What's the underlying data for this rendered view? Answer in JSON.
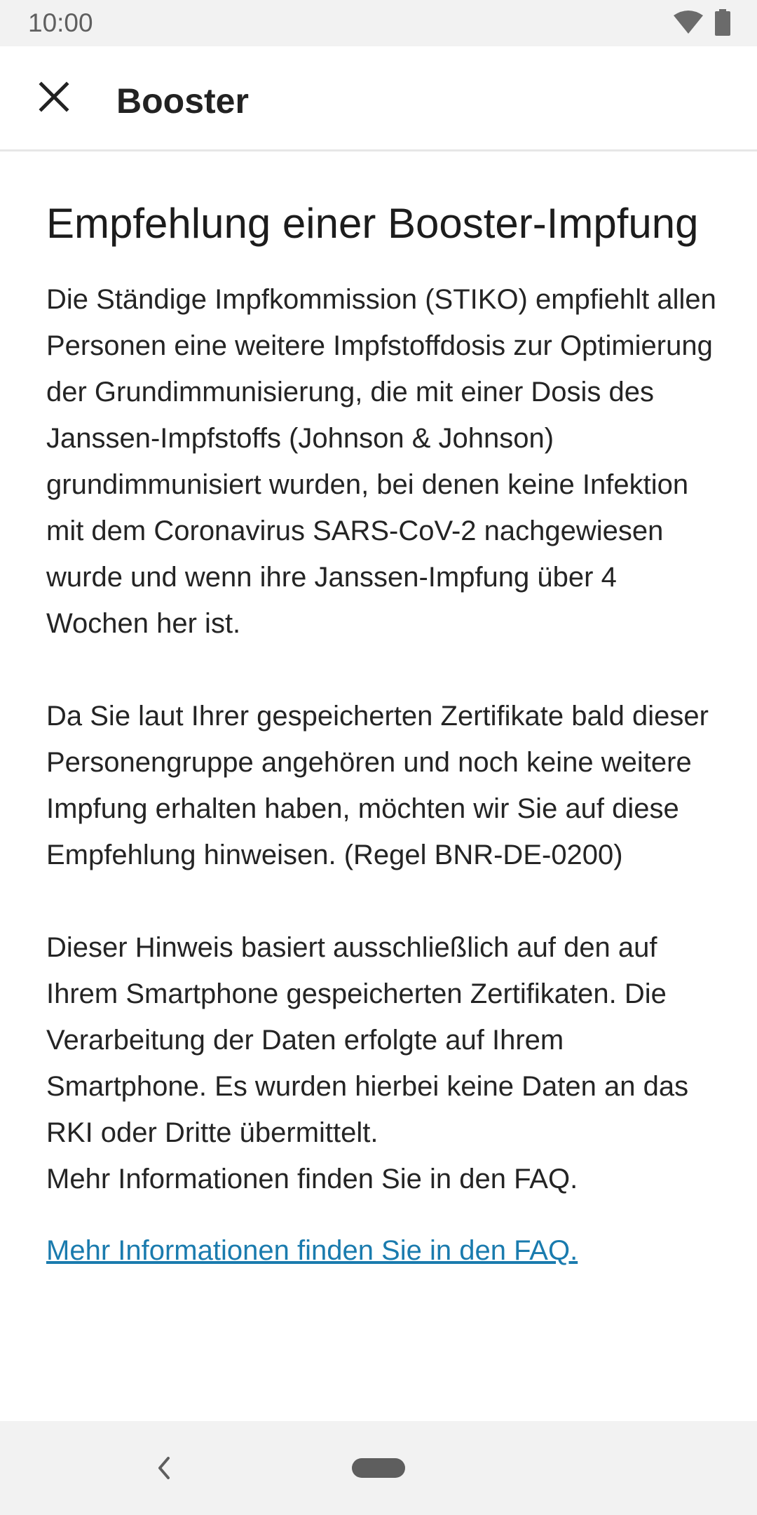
{
  "status_bar": {
    "time": "10:00",
    "icons": [
      "wifi-icon",
      "battery-icon"
    ]
  },
  "app_bar": {
    "close_icon": "close-icon",
    "title": "Booster"
  },
  "content": {
    "headline": "Empfehlung einer Booster-Impfung",
    "body": "Die Ständige Impfkommission (STIKO) empfiehlt allen Personen eine weitere Impfstoffdosis zur Optimierung der Grundimmunisierung, die mit einer Dosis des Janssen-Impfstoffs (Johnson & Johnson) grundimmunisiert wurden, bei denen keine Infektion mit dem Coronavirus SARS-CoV-2 nachgewiesen wurde und wenn ihre Janssen-Impfung über 4 Wochen her ist.\n\n Da Sie laut Ihrer gespeicherten Zertifikate bald dieser Personengruppe angehören und noch keine weitere Impfung erhalten haben, möchten wir Sie auf diese Empfehlung hinweisen. (Regel BNR-DE-0200)\n\n Dieser Hinweis basiert ausschließlich auf den auf Ihrem Smartphone gespeicherten Zertifikaten. Die Verarbeitung der Daten erfolgte auf Ihrem Smartphone. Es wurden hierbei keine Daten an das RKI oder Dritte übermittelt.\nMehr Informationen finden Sie in den FAQ.",
    "faq_link": "Mehr Informationen finden Sie in den FAQ."
  },
  "nav_bar": {
    "back_icon": "back-icon",
    "home_icon": "home-pill-icon"
  },
  "colors": {
    "link": "#1a7bae",
    "system_bar_bg": "#f2f2f2",
    "text": "#242424"
  }
}
